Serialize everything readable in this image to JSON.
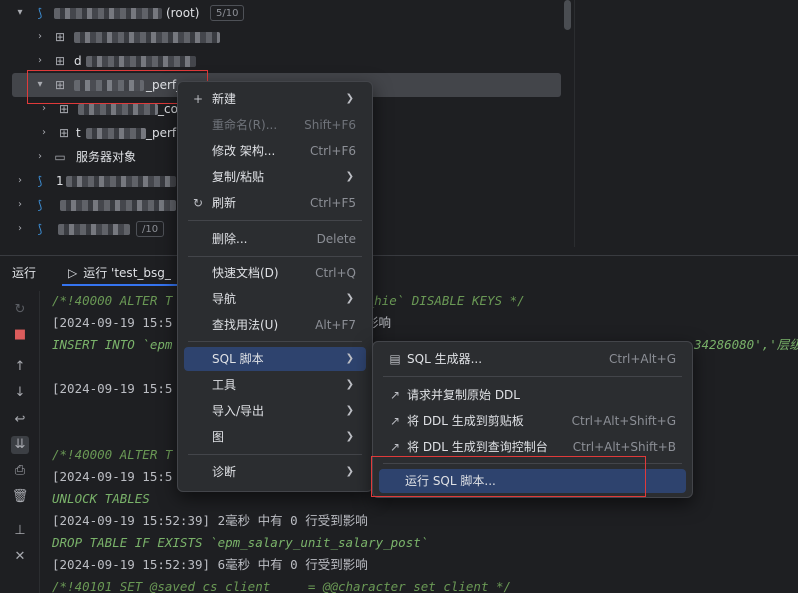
{
  "tree": {
    "root_label": "(root)",
    "root_badge": "5/10",
    "schema_suffix": "_perf_",
    "item_co": "_co",
    "item_perf": "_perf",
    "server_objects": "服务器对象",
    "item_d": "d",
    "item_t": "t",
    "badge_10": "/10",
    "item_1": "1"
  },
  "context_menu": {
    "items": [
      {
        "label": "新建",
        "shortcut": "",
        "submenu": true,
        "enabled": true,
        "icon": "plus-icon"
      },
      {
        "label": "重命名(R)...",
        "shortcut": "Shift+F6",
        "submenu": false,
        "enabled": false
      },
      {
        "label": "修改 架构...",
        "shortcut": "Ctrl+F6",
        "submenu": false,
        "enabled": true
      },
      {
        "label": "复制/粘贴",
        "shortcut": "",
        "submenu": true,
        "enabled": true
      },
      {
        "label": "刷新",
        "shortcut": "Ctrl+F5",
        "submenu": false,
        "enabled": true,
        "icon": "refresh-icon"
      },
      {
        "label": "删除...",
        "shortcut": "Delete",
        "submenu": false,
        "enabled": true
      },
      {
        "label": "快速文档(D)",
        "shortcut": "Ctrl+Q",
        "submenu": false,
        "enabled": true
      },
      {
        "label": "导航",
        "shortcut": "",
        "submenu": true,
        "enabled": true
      },
      {
        "label": "查找用法(U)",
        "shortcut": "Alt+F7",
        "submenu": false,
        "enabled": true
      },
      {
        "label": "SQL 脚本",
        "shortcut": "",
        "submenu": true,
        "enabled": true,
        "highlighted": true
      },
      {
        "label": "工具",
        "shortcut": "",
        "submenu": true,
        "enabled": true
      },
      {
        "label": "导入/导出",
        "shortcut": "",
        "submenu": true,
        "enabled": true
      },
      {
        "label": "图",
        "shortcut": "",
        "submenu": true,
        "enabled": true
      },
      {
        "label": "诊断",
        "shortcut": "",
        "submenu": true,
        "enabled": true
      }
    ]
  },
  "sql_submenu": {
    "items": [
      {
        "label": "SQL 生成器...",
        "shortcut": "Ctrl+Alt+G",
        "icon": "sql-generator-icon"
      },
      {
        "label": "请求并复制原始 DDL",
        "shortcut": "",
        "icon": "external-link-icon"
      },
      {
        "label": "将 DDL 生成到剪贴板",
        "shortcut": "Ctrl+Alt+Shift+G",
        "icon": "external-link-icon"
      },
      {
        "label": "将 DDL 生成到查询控制台",
        "shortcut": "Ctrl+Alt+Shift+B",
        "icon": "external-link-icon"
      },
      {
        "label": "运行 SQL 脚本...",
        "shortcut": "",
        "highlighted": true
      }
    ]
  },
  "run_panel": {
    "title": "运行",
    "tab_label": "运行 'test_bsg_"
  },
  "console": {
    "lines": [
      {
        "text": "/*!40000 ALTER T",
        "tail": "alary_hie` DISABLE KEYS */",
        "style": "green"
      },
      {
        "text": "[2024-09-19 15:5",
        "tail": "影响",
        "style": "white"
      },
      {
        "text": "INSERT INTO `epm",
        "tail": "34286080','层级",
        "style": "green2"
      },
      {
        "text": "[2024-09-19 15:5",
        "tail": "",
        "style": "white"
      },
      {
        "text": "/*!40000 ALTER T",
        "tail": "",
        "style": "green"
      },
      {
        "text": "[2024-09-19 15:5",
        "tail": "",
        "style": "white"
      },
      {
        "text": "UNLOCK TABLES",
        "tail": "",
        "style": "green2"
      },
      {
        "text": "[2024-09-19 15:52:39] 2毫秒 中有 0 行受到影响",
        "tail": "",
        "style": "white"
      },
      {
        "text": "DROP TABLE IF EXISTS `epm_salary_unit_salary_post`",
        "tail": "",
        "style": "green2"
      },
      {
        "text": "[2024-09-19 15:52:39] 6毫秒 中有 0 行受到影响",
        "tail": "",
        "style": "white"
      },
      {
        "text": "/*!40101 SET @saved_cs_client     = @@character_set_client */",
        "tail": "",
        "style": "green"
      }
    ]
  }
}
